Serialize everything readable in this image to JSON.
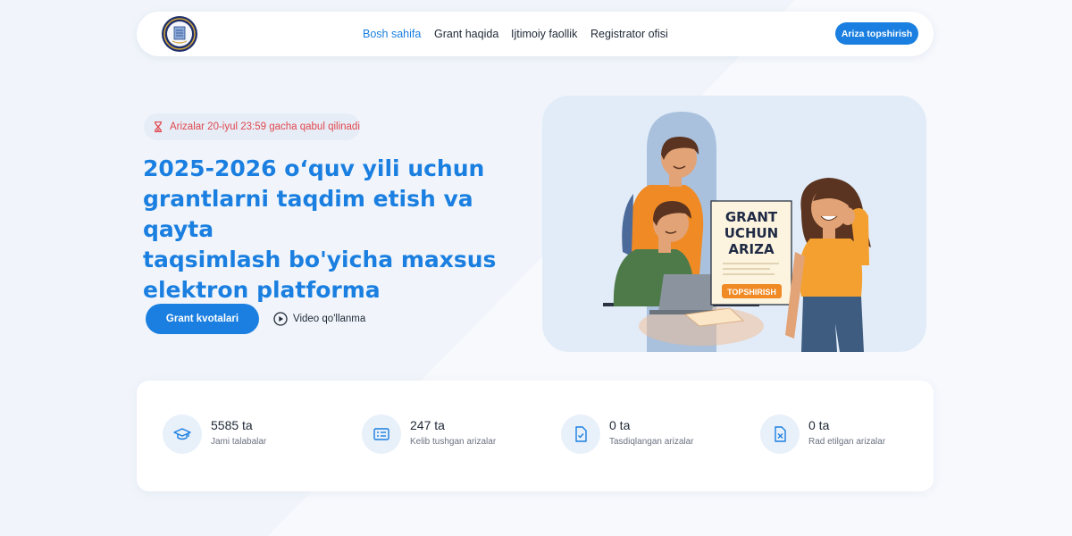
{
  "nav": {
    "items": [
      {
        "label": "Bosh sahifa",
        "active": true
      },
      {
        "label": "Grant haqida",
        "active": false
      },
      {
        "label": "Ijtimoiy faollik",
        "active": false
      },
      {
        "label": "Registrator ofisi",
        "active": false
      }
    ],
    "apply_button": "Ariza topshirish"
  },
  "hero": {
    "deadline": "Arizalar 20-iyul 23:59 gacha qabul qilinadi",
    "title_lines": [
      "2025-2026 o‘quv yili uchun",
      "grantlarni taqdim etish va qayta",
      "taqsimlash bo'yicha maxsus",
      "elektron platforma"
    ],
    "primary_button": "Grant kvotalari",
    "video_link": "Video qo'llanma"
  },
  "illustration": {
    "doc_lines": [
      "GRANT",
      "UCHUN",
      "ARIZA"
    ],
    "doc_button": "TOPSHIRISH"
  },
  "stats": [
    {
      "icon": "graduation-cap-icon",
      "value": "5585 ta",
      "label": "Jami talabalar"
    },
    {
      "icon": "list-card-icon",
      "value": "247 ta",
      "label": "Kelib tushgan arizalar"
    },
    {
      "icon": "document-check-icon",
      "value": "0 ta",
      "label": "Tasdiqlangan arizalar"
    },
    {
      "icon": "document-x-icon",
      "value": "0 ta",
      "label": "Rad etilgan arizalar"
    }
  ],
  "colors": {
    "accent": "#1a7fe0",
    "warning_text": "#e0474f",
    "background": "#f3f7fc"
  }
}
